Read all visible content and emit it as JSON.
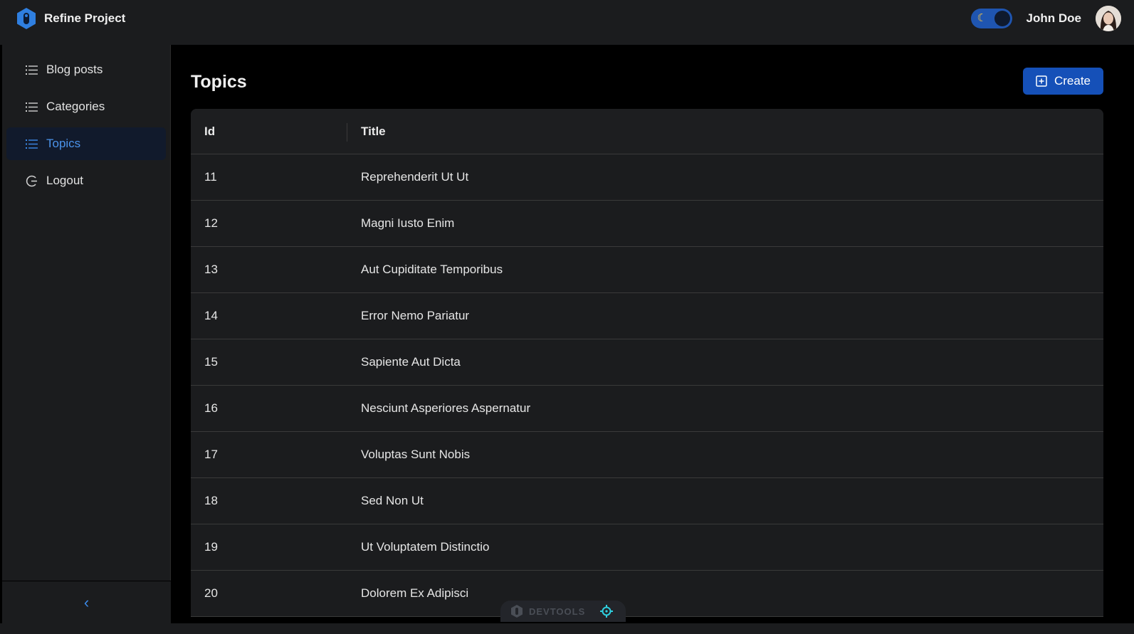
{
  "app": {
    "brand_name": "Refine Project",
    "user_name": "John Doe",
    "accent_color": "#3c89e8",
    "theme_mode": "dark"
  },
  "sidebar": {
    "items": [
      {
        "label": "Blog posts",
        "icon": "list-icon",
        "active": false
      },
      {
        "label": "Categories",
        "icon": "list-icon",
        "active": false
      },
      {
        "label": "Topics",
        "icon": "list-icon",
        "active": true
      },
      {
        "label": "Logout",
        "icon": "logout-icon",
        "active": false
      }
    ],
    "collapse_icon": "chevron-left-icon"
  },
  "page": {
    "title": "Topics",
    "create_label": "Create"
  },
  "table": {
    "columns": [
      "Id",
      "Title"
    ],
    "rows": [
      {
        "id": "11",
        "title": "Reprehenderit Ut Ut"
      },
      {
        "id": "12",
        "title": "Magni Iusto Enim"
      },
      {
        "id": "13",
        "title": "Aut Cupiditate Temporibus"
      },
      {
        "id": "14",
        "title": "Error Nemo Pariatur"
      },
      {
        "id": "15",
        "title": "Sapiente Aut Dicta"
      },
      {
        "id": "16",
        "title": "Nesciunt Asperiores Aspernatur"
      },
      {
        "id": "17",
        "title": "Voluptas Sunt Nobis"
      },
      {
        "id": "18",
        "title": "Sed Non Ut"
      },
      {
        "id": "19",
        "title": "Ut Voluptatem Distinctio"
      },
      {
        "id": "20",
        "title": "Dolorem Ex Adipisci"
      }
    ]
  },
  "devtools": {
    "label": "DEVTOOLS"
  }
}
